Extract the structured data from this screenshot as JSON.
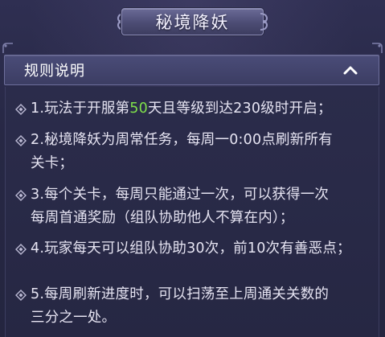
{
  "title": "秘境降妖",
  "header": {
    "label": "规则说明",
    "expanded": true
  },
  "rules": [
    {
      "prefix": "1.玩法于开服第",
      "highlight": "50",
      "suffix": "天且等级到达230级时开启；"
    },
    {
      "line1": "2.秘境降妖为周常任务，每周一0:00点刷新所有",
      "line2": "关卡；"
    },
    {
      "line1": "3.每个关卡，每周只能通过一次，可以获得一次",
      "line2": "每周首通奖励（组队协助他人不算在内）；"
    },
    {
      "line1": "4.玩家每天可以组队协助30次，前10次有善恶点；"
    },
    {
      "line1": "5.每周刷新进度时，可以扫荡至上周通关关数的",
      "line2": "三分之一处。"
    }
  ],
  "colors": {
    "highlight": "#7fe14a",
    "text": "#e6e4f2",
    "background": "#2a2b48"
  },
  "icons": {
    "bullet": "diamond-bullet-icon",
    "collapse": "chevron-up-icon"
  }
}
